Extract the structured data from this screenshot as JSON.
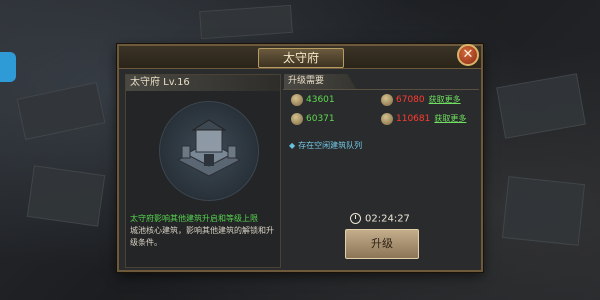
{
  "panel": {
    "title": "太守府",
    "close_icon": "close-icon"
  },
  "building": {
    "name_level": "太守府  Lv.16",
    "image": "fortress-building-icon"
  },
  "description": {
    "effect": "太守府影响其他建筑升启和等级上限",
    "detail": "城池核心建筑，影响其他建筑的解锁和升级条件。"
  },
  "requirements": {
    "header": "升级需要",
    "resources": [
      {
        "icon": "food-icon",
        "value": "43601",
        "status": "ok"
      },
      {
        "icon": "wood-icon",
        "value": "67080",
        "status": "insufficient",
        "link": "获取更多"
      },
      {
        "icon": "stone-icon",
        "value": "60371",
        "status": "ok"
      },
      {
        "icon": "iron-icon",
        "value": "110681",
        "status": "insufficient",
        "link": "获取更多"
      }
    ],
    "queue_text": "存在空闲建筑队列"
  },
  "upgrade": {
    "timer": "02:24:27",
    "button_label": "升级"
  },
  "colors": {
    "ok": "#5fd94f",
    "insufficient": "#ff3b2f",
    "queue": "#74c9e6",
    "frame": "#6d5a3c"
  }
}
